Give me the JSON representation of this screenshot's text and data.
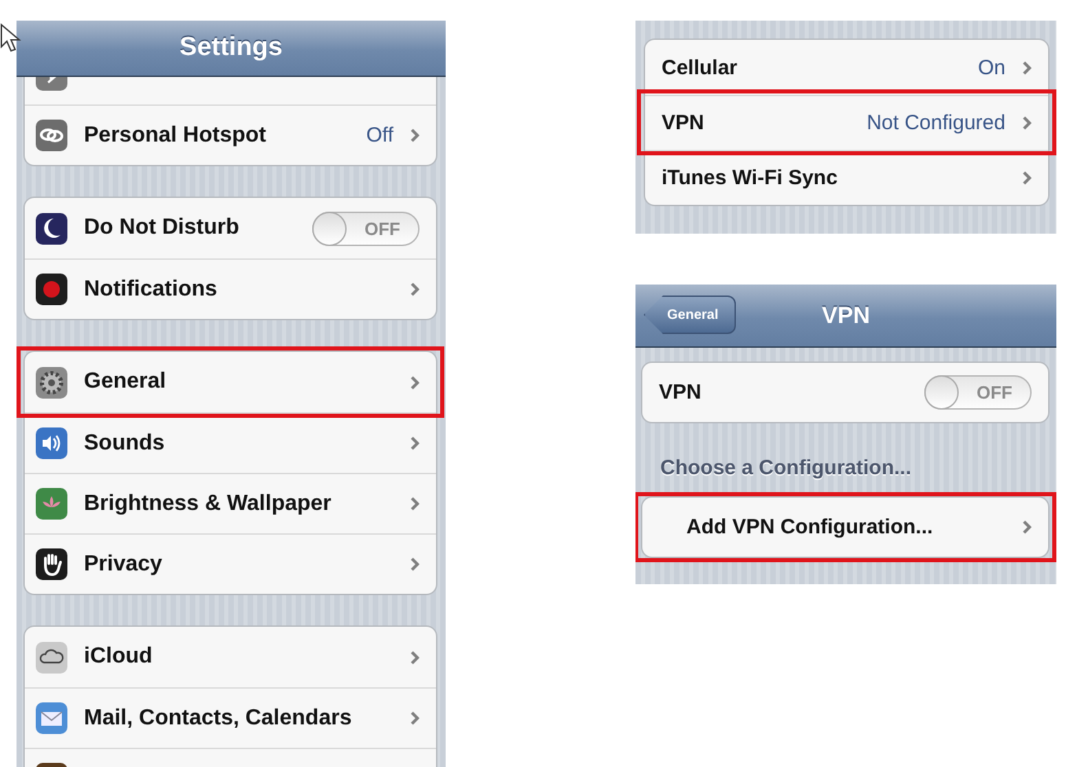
{
  "screens": [
    {
      "kind": "settings",
      "nav": {
        "title": "Settings"
      },
      "groups": [
        {
          "rows": [
            {
              "kind": "cut"
            },
            {
              "kind": "link",
              "label": "Personal Hotspot",
              "value": "Off",
              "highlighted": false
            }
          ]
        },
        {
          "rows": [
            {
              "kind": "toggle",
              "label": "Do Not Disturb",
              "toggle": {
                "on": false,
                "label": "OFF"
              },
              "highlighted": false
            },
            {
              "kind": "link",
              "label": "Notifications",
              "highlighted": false
            }
          ]
        },
        {
          "rows": [
            {
              "kind": "link",
              "label": "General",
              "highlighted": true
            },
            {
              "kind": "link",
              "label": "Sounds",
              "highlighted": false
            },
            {
              "kind": "link",
              "label": "Brightness & Wallpaper",
              "highlighted": false
            },
            {
              "kind": "link",
              "label": "Privacy",
              "highlighted": false
            }
          ]
        },
        {
          "rows": [
            {
              "kind": "link",
              "label": "iCloud",
              "highlighted": false
            },
            {
              "kind": "link",
              "label": "Mail, Contacts, Calendars",
              "highlighted": false
            },
            {
              "kind": "cut"
            }
          ]
        }
      ]
    },
    {
      "kind": "plain",
      "groups": [
        {
          "rows": [
            {
              "kind": "link",
              "label": "Cellular",
              "value": "On",
              "highlighted": false
            },
            {
              "kind": "link",
              "label": "VPN",
              "value": "Not Configured",
              "highlighted": true
            },
            {
              "kind": "link",
              "label": "iTunes Wi-Fi Sync",
              "highlighted": false
            }
          ]
        }
      ]
    },
    {
      "kind": "detail",
      "nav": {
        "title": "VPN",
        "back": "General"
      },
      "groups": [
        {
          "rows": [
            {
              "kind": "toggle",
              "label": "VPN",
              "toggle": {
                "on": false,
                "label": "OFF"
              },
              "highlighted": false
            }
          ]
        },
        {
          "header": "Choose a Configuration...",
          "rows": [
            {
              "kind": "action",
              "label": "Add VPN Configuration...",
              "highlighted": true
            }
          ]
        }
      ]
    }
  ]
}
